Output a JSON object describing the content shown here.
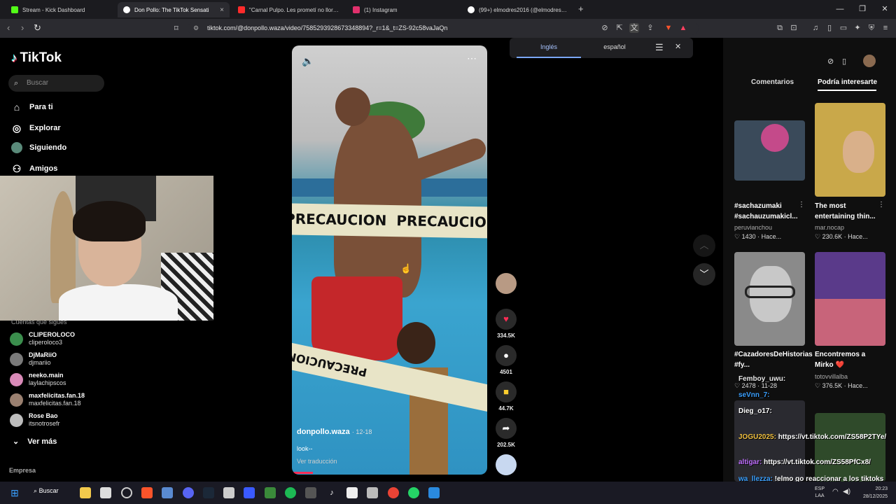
{
  "browser": {
    "tabs": [
      {
        "title": "Stream - Kick Dashboard",
        "color": "#53fc18"
      },
      {
        "title": "Don Pollo: The TikTok Sensati",
        "color": "#ffffff"
      },
      {
        "title": "\"Carnal Pulpo. Les prometí no llorar,",
        "color": "#ff2b2b"
      },
      {
        "title": "(1) Instagram",
        "color": "#e1306c"
      },
      {
        "title": "(99+) elmodres2016 (@elmodres2016",
        "color": "#ffffff"
      }
    ],
    "new_tab": "+",
    "url": "tiktok.com/@donpollo.waza/video/7585293928673348894?_r=1&_t=ZS-92c58vaJaQn"
  },
  "translate": {
    "lang_from": "Inglés",
    "lang_to": "español"
  },
  "sidebar": {
    "logo": "TikTok",
    "search_placeholder": "Buscar",
    "nav": [
      {
        "label": "Para ti",
        "icon": "home-icon"
      },
      {
        "label": "Explorar",
        "icon": "compass-icon"
      },
      {
        "label": "Siguiendo",
        "icon": "following-icon"
      },
      {
        "label": "Amigos",
        "icon": "friends-icon"
      }
    ],
    "following_header": "Cuentas que sigues",
    "accounts": [
      {
        "name": "CLIPEROLOCO",
        "user": "cliperoloco3",
        "color": "#4caf50"
      },
      {
        "name": "DjMaRiiO",
        "user": "djmariio",
        "color": "#8a8a8a"
      },
      {
        "name": "neeko.main",
        "user": "laylachipscos",
        "color": "#e8a0c8"
      },
      {
        "name": "maxfelicitas.fan.18",
        "user": "maxfelicitas.fan.18",
        "color": "#a08a7a"
      },
      {
        "name": "Rose Bao",
        "user": "itsnotrosefr",
        "color": "#c0c0c0"
      }
    ],
    "see_more": "Ver más",
    "company": "Empresa"
  },
  "video": {
    "author": "donpollo.waza",
    "date": "· 12-18",
    "caption": "look--",
    "see_translation": "Ver traducción",
    "tape_text": "PRECAUCION"
  },
  "actions": {
    "likes": "334.5K",
    "comments": "4501",
    "saves": "44.7K",
    "shares": "202.5K"
  },
  "panel": {
    "tab_comments": "Comentarios",
    "tab_recommended": "Podría interesarte",
    "cards": [
      {
        "title": "#sachazumaki #sachauzumakicl...",
        "user": "peruvianchou",
        "likes": "1430",
        "time": "· Hace...",
        "color": "#3a4a5a"
      },
      {
        "title": "The most entertaining thin...",
        "user": "mar.nocap",
        "likes": "230.6K",
        "time": "· Hace...",
        "color": "#c9a84a"
      },
      {
        "title": "#CazadoresDeHistorias #fy...",
        "user": "",
        "likes": "2478",
        "time": "· 11-28",
        "color": "#9a9a9a"
      },
      {
        "title": "Encontremos a Mirko ❤️",
        "user": "totovvillalba",
        "likes": "376.5K",
        "time": "· Hace...",
        "color": "#c8647a"
      }
    ]
  },
  "chat": [
    {
      "user": "Femboy_uwu:",
      "msg": "",
      "color": "#e8e8e8"
    },
    {
      "user": "seVnn_7:",
      "msg": "",
      "color": "#3aa0ff"
    },
    {
      "user": "Dieg_o17:",
      "msg": "",
      "color": "#ffffff"
    },
    {
      "user": "JOGU2025:",
      "msg": "https://vt.tiktok.com/ZS58P2TYe/",
      "color": "#f0c040"
    },
    {
      "user": "altigar:",
      "msg": "https://vt.tiktok.com/ZS58PfCx8/",
      "color": "#c070ff"
    },
    {
      "user": "wa_llezza:",
      "msg": "!elmo go reaccionar a los tiktoks de carnal pulpo",
      "color": "#3aa0ff"
    }
  ],
  "taskbar": {
    "search": "Buscar",
    "lang": "ESP LAA",
    "time": "20:23",
    "date": "28/12/2025"
  }
}
